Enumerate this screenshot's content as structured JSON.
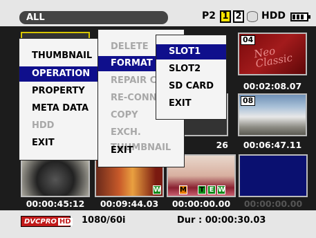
{
  "header": {
    "filter_label": "ALL",
    "card_label": "P2",
    "slot1": "1",
    "slot2": "2",
    "hdd_label": "HDD",
    "battery_icon": "battery-icon"
  },
  "clips": [
    {
      "id": "c01",
      "number": "",
      "time": "",
      "visible_time": false
    },
    {
      "id": "c04",
      "number": "04",
      "time": "00:02:08.07",
      "thumb_text": "Neo Classic"
    },
    {
      "id": "c08",
      "number": "08",
      "time": "00:06:47.11"
    },
    {
      "id": "c07",
      "number": "",
      "time": "26"
    },
    {
      "id": "c09",
      "number": "",
      "time": "00:00:45:12"
    },
    {
      "id": "c10",
      "number": "",
      "time": "00:09:44.03"
    },
    {
      "id": "c11",
      "number": "",
      "time": "00:00:00.00"
    },
    {
      "id": "c12",
      "number": "",
      "time": "00:00:00.00"
    }
  ],
  "badges": {
    "w": "W",
    "m": "M",
    "t": "T",
    "e": "E",
    "w2": "W"
  },
  "menu_main": {
    "items": [
      {
        "label": "THUMBNAIL",
        "has_sub": true,
        "disabled": false,
        "selected": false
      },
      {
        "label": "OPERATION",
        "has_sub": true,
        "disabled": false,
        "selected": true
      },
      {
        "label": "PROPERTY",
        "has_sub": true,
        "disabled": false,
        "selected": false
      },
      {
        "label": "META DATA",
        "has_sub": true,
        "disabled": false,
        "selected": false
      },
      {
        "label": "HDD",
        "has_sub": true,
        "disabled": true,
        "selected": false
      },
      {
        "label": "EXIT",
        "has_sub": false,
        "disabled": false,
        "selected": false
      }
    ]
  },
  "menu_operation": {
    "items": [
      {
        "label": "DELETE",
        "disabled": true,
        "selected": false
      },
      {
        "label": "FORMAT",
        "disabled": false,
        "selected": true
      },
      {
        "label": "REPAIR C",
        "disabled": true,
        "selected": false
      },
      {
        "label": "RE-CONN",
        "disabled": true,
        "selected": false
      },
      {
        "label": "COPY",
        "disabled": true,
        "selected": false
      },
      {
        "label": "EXCH. THUMBNAIL",
        "disabled": true,
        "selected": false
      },
      {
        "label": "EXIT",
        "disabled": false,
        "selected": false
      }
    ]
  },
  "menu_format": {
    "items": [
      {
        "label": "SLOT1",
        "selected": true
      },
      {
        "label": "SLOT2",
        "selected": false
      },
      {
        "label": "SD CARD",
        "selected": false
      },
      {
        "label": "EXIT",
        "selected": false
      }
    ]
  },
  "status": {
    "codec_label": "DVCPRO",
    "codec_hd": "HD",
    "format": "1080/60i",
    "duration": "Dur : 00:00:30.03"
  }
}
